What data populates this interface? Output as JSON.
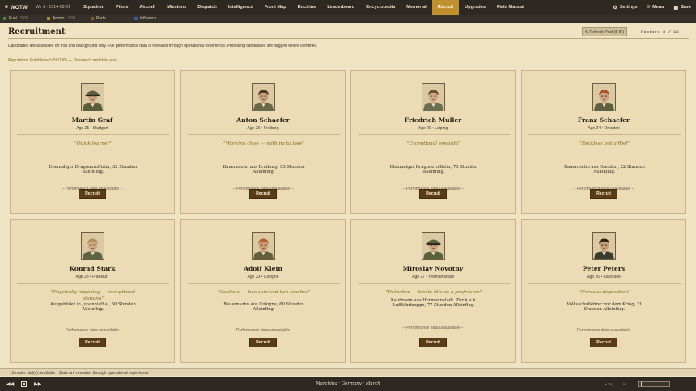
{
  "app": {
    "brand": "WOTW",
    "week": "Wk 1 · 1914-08-01"
  },
  "nav": [
    "Squadron",
    "Pilots",
    "Aircraft",
    "Missions",
    "Dispatch",
    "Intelligence",
    "Front Map",
    "Doctrine",
    "Leaderboard",
    "Encyclopedia",
    "Memorial",
    "Recruit",
    "Upgrades",
    "Field Manual"
  ],
  "nav_active": "Recruit",
  "top_actions": {
    "settings": "Settings",
    "menu": "Menu",
    "save": "Save"
  },
  "resources": [
    {
      "label": "Fuel",
      "value": "3.00",
      "color": "#3f8a3a"
    },
    {
      "label": "Ammo",
      "value": "3.00",
      "color": "#b08a2a"
    },
    {
      "label": "Parts",
      "value": "",
      "color": "#8a5a2a"
    },
    {
      "label": "Influence",
      "value": "",
      "color": "#3a5a9a"
    }
  ],
  "page": {
    "title": "Recruitment",
    "refresh_label": "↻ Refresh Pool (5 IP)",
    "roster": "Roster: 3 / 16",
    "intro": "Candidates are assessed on trait and background only. Full performance data is revealed through operational experience. Promising candidates are flagged where identified.",
    "reputation": "Reputation: Established (59/100) — Standard candidate pool"
  },
  "candidates": [
    {
      "name": "Martin Graf",
      "meta": "Age 25  •  Stuttgart",
      "trait": "\"Quick learner\"",
      "background": "Ehemaliger Dragoneroffizier, 32 Stunden Alleinflug.",
      "perf": "– Performance data unavailable –",
      "recruit": "Recruit",
      "hair": "#5a4026",
      "uniform": "#5b5f3c",
      "cap": true,
      "skin": "#caa57f"
    },
    {
      "name": "Anton Schaefer",
      "meta": "Age 26  •  Freiburg",
      "trait": "\"Working class — nothing to lose\"",
      "background": "Bauernsohn aus Freiburg, 63 Stunden Alleinflug.",
      "perf": "– Performance data unavailable –",
      "recruit": "Recruit",
      "hair": "#4a3422",
      "uniform": "#6a6a48",
      "cap": false,
      "skin": "#c79d78"
    },
    {
      "name": "Friedrich Muller",
      "meta": "Age 29  •  Leipzig",
      "trait": "\"Exceptional eyesight\"",
      "background": "Ehemaliger Dragoneroffizier, 73 Stunden Alleinflug.",
      "perf": "– Performance data unavailable –",
      "recruit": "Recruit",
      "hair": "#6a4a2c",
      "uniform": "#6b6e50",
      "cap": false,
      "skin": "#cfa886"
    },
    {
      "name": "Franz Schaefer",
      "meta": "Age 24  •  Dresden",
      "trait": "\"Reckless but gifted\"",
      "background": "Bauernsohn aus Dresden, 22 Stunden Alleinflug.",
      "perf": "– Performance data unavailable –",
      "recruit": "Recruit",
      "hair": "#a5522a",
      "uniform": "#5d6142",
      "cap": false,
      "skin": "#d0a282"
    },
    {
      "name": "Konrad Stark",
      "meta": "Age 23  •  Frankfurt",
      "trait": "\"Physically imposing — exceptional stamina\"",
      "background": "Ausgebildet in Johannisthal, 56 Stunden Alleinflug.",
      "perf": "– Performance data unavailable –",
      "recruit": "Recruit",
      "hair": "#b08e58",
      "uniform": "#5d6445",
      "cap": false,
      "skin": "#cda683"
    },
    {
      "name": "Adolf Klein",
      "meta": "Age 33  •  Cologne",
      "trait": "\"Cautious — has survived two crashes\"",
      "background": "Bauernsohn aus Cologne, 60 Stunden Alleinflug.",
      "perf": "– Performance data unavailable –",
      "recruit": "Recruit",
      "hair": "#b0602e",
      "uniform": "#64603e",
      "cap": false,
      "skin": "#c89a76"
    },
    {
      "name": "Miroslav Novotny",
      "meta": "Age 27  •  Hermannstadt",
      "trait": "\"Detached — treats this as a profession\"",
      "background": "Kaufmann aus Hermannstadt. Zur k.u.k. Luftfahrtruppe, 77 Stunden Alleinflug.",
      "perf": "– Performance data unavailable –",
      "recruit": "Recruit",
      "hair": "#4a3a26",
      "uniform": "#5c6240",
      "cap": true,
      "skin": "#cba27e"
    },
    {
      "name": "Peter Peters",
      "meta": "Age 26  •  Karlsruhe",
      "trait": "\"Nervous disposition\"",
      "background": "Volksschullehrer vor dem Krieg, 31 Stunden Alleinflug.",
      "perf": "– Performance data unavailable –",
      "recruit": "Recruit",
      "hair": "#2e2218",
      "uniform": "#3d3a30",
      "cap": false,
      "skin": "#c49d7c"
    }
  ],
  "status_strip": "13 roster stat(s) available · Stats are revealed through operational experience",
  "bottom": {
    "status": "Marching · Germany · March",
    "prev": "◀◀",
    "next": "▶▶",
    "time": "• Tag",
    "vol": "Vol"
  }
}
